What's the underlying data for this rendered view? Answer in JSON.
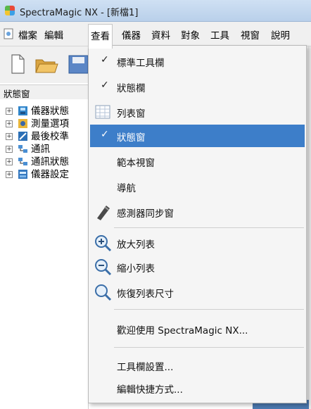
{
  "window": {
    "title": "SpectraMagic NX - [新檔1]"
  },
  "menubar": {
    "items": [
      {
        "label": "檔案"
      },
      {
        "label": "編輯"
      },
      {
        "label": "查看"
      },
      {
        "label": "儀器"
      },
      {
        "label": "資料"
      },
      {
        "label": "對象"
      },
      {
        "label": "工具"
      },
      {
        "label": "視窗"
      },
      {
        "label": "說明"
      }
    ],
    "active": "查看"
  },
  "toolbar": {
    "icons": [
      "new-document-icon",
      "open-folder-icon",
      "save-icon"
    ]
  },
  "status_window": {
    "label": "狀態窗",
    "tree": [
      {
        "label": "儀器狀態",
        "icon": "instrument-icon"
      },
      {
        "label": "測量選項",
        "icon": "measurement-options-icon"
      },
      {
        "label": "最後校準",
        "icon": "calibration-icon"
      },
      {
        "label": "通訊",
        "icon": "communication-icon"
      },
      {
        "label": "通訊狀態",
        "icon": "communication-status-icon"
      },
      {
        "label": "儀器設定",
        "icon": "instrument-settings-icon"
      }
    ]
  },
  "view_menu": {
    "highlighted": "狀態窗",
    "items": [
      {
        "label": "標準工具欄",
        "checked": true
      },
      {
        "label": "狀態欄",
        "checked": true
      },
      {
        "label": "列表窗",
        "icon": "list-window-icon"
      },
      {
        "label": "狀態窗",
        "checked": true
      },
      {
        "label": "範本視窗"
      },
      {
        "label": "導航"
      },
      {
        "label": "感測器同步窗",
        "icon": "sensor-sync-icon"
      },
      {
        "label": "放大列表",
        "icon": "zoom-in-icon"
      },
      {
        "label": "縮小列表",
        "icon": "zoom-out-icon"
      },
      {
        "label": "恢復列表尺寸",
        "icon": "restore-size-icon"
      },
      {
        "label": "歡迎使用 SpectraMagic NX..."
      },
      {
        "label": "工具欄設置..."
      },
      {
        "label": "編輯快捷方式..."
      }
    ],
    "check_mark": "✓"
  },
  "colors": {
    "highlight": "#3d7ec9",
    "menu_bg": "#f5f5f5",
    "titlebar": "#c4d7ee"
  }
}
